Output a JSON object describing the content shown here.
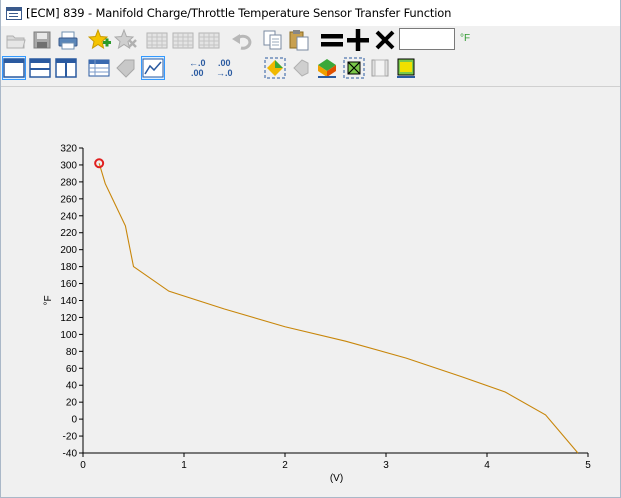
{
  "window": {
    "title": "[ECM] 839 - Manifold Charge/Throttle Temperature Sensor Transfer Function"
  },
  "toolbar1": {
    "buttons": [
      "open-folder-icon",
      "save-icon",
      "print-icon",
      "add-favorite-icon",
      "remove-favorite-icon",
      "table-grid-icon",
      "table-grid-alt-icon",
      "table-grid-edit-icon",
      "undo-icon",
      "copy-icon",
      "paste-icon",
      "equals-icon",
      "plus-icon",
      "multiply-icon"
    ],
    "value_input": "",
    "unit_label": "°F"
  },
  "toolbar2": {
    "buttons": [
      "layout-single-icon",
      "layout-horizontal-split-icon",
      "layout-vertical-split-icon",
      "table-view-icon",
      "tag-icon",
      "graph-view-icon",
      "increase-decimal-icon",
      "decrease-decimal-icon",
      "select-all-icon",
      "lasso-icon",
      "interpolate-icon",
      "select-box-icon",
      "frame-icon",
      "fill-icon"
    ],
    "increase_decimal_top": "←.0",
    "increase_decimal_bottom": ".00",
    "decrease_decimal_top": ".00",
    "decrease_decimal_bottom": "→.0"
  },
  "chart_data": {
    "type": "line",
    "xlabel": "(V)",
    "ylabel": "°F",
    "xlim": [
      0,
      5
    ],
    "ylim": [
      -40,
      320
    ],
    "x_ticks": [
      0,
      1,
      2,
      3,
      4,
      5
    ],
    "y_ticks": [
      -40,
      -20,
      0,
      20,
      40,
      60,
      80,
      100,
      120,
      140,
      160,
      180,
      200,
      220,
      240,
      260,
      280,
      300,
      320
    ],
    "series": [
      {
        "color": "#c8860a",
        "x": [
          0.16,
          0.22,
          0.3,
          0.42,
          0.5,
          0.85,
          1.4,
          2.0,
          2.6,
          3.2,
          3.75,
          4.18,
          4.58,
          4.9
        ],
        "y": [
          302,
          278,
          258,
          228,
          180,
          151,
          130,
          109,
          92,
          72,
          50,
          32,
          5,
          -40
        ]
      }
    ],
    "highlight_point": {
      "x": 0.16,
      "y": 302,
      "color": "#e02020"
    },
    "grid": false
  }
}
